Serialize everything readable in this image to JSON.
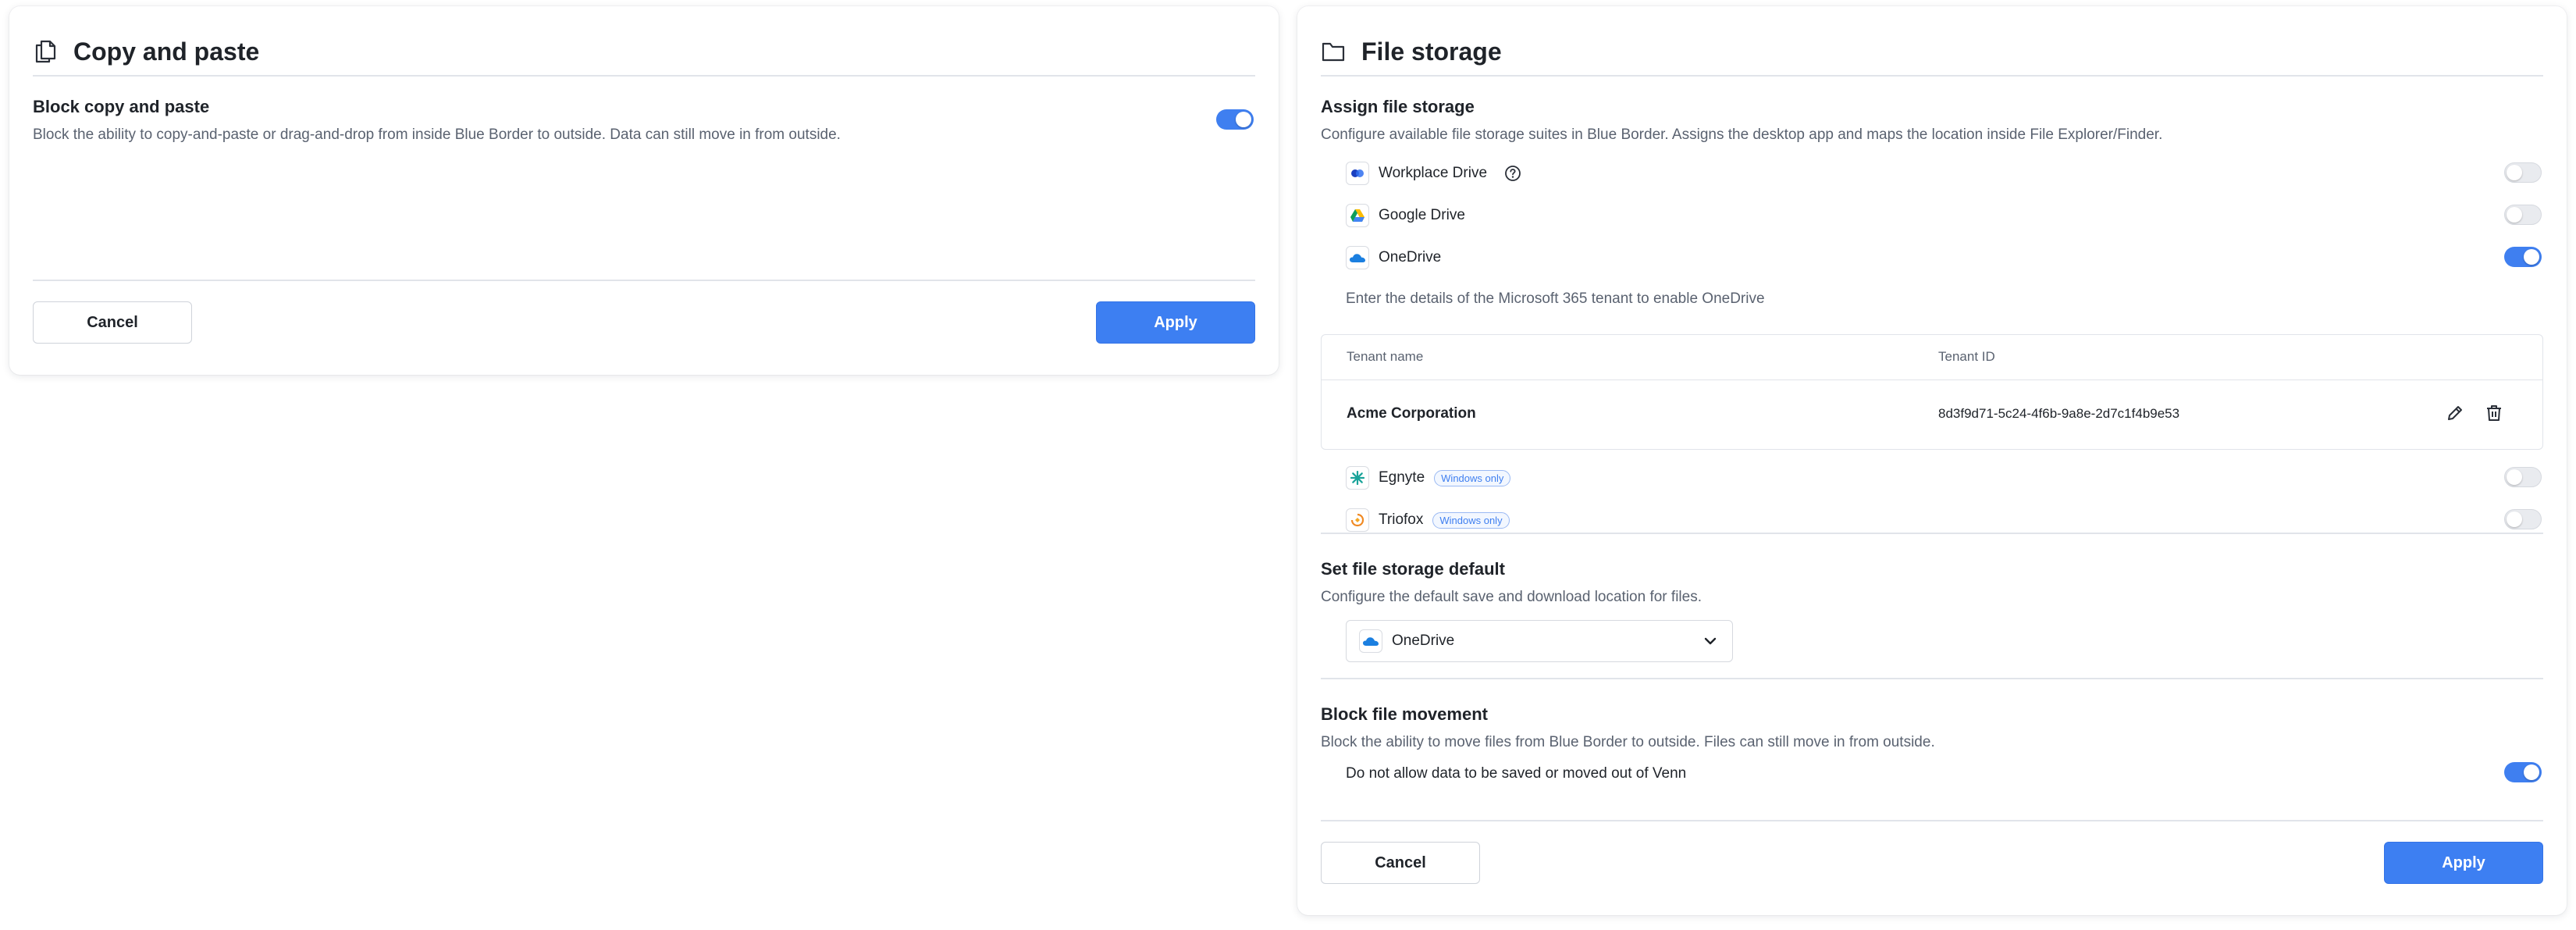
{
  "copy_paste": {
    "title": "Copy and paste",
    "icon": "copy-icon",
    "setting_title": "Block copy and paste",
    "setting_desc": "Block the ability to copy-and-paste or drag-and-drop from inside Blue Border to outside. Data can still move in from outside.",
    "toggle_on": true,
    "cancel_label": "Cancel",
    "apply_label": "Apply"
  },
  "file_storage": {
    "title": "File storage",
    "icon": "folder-icon",
    "assign": {
      "title": "Assign file storage",
      "desc": "Configure available file storage suites in Blue Border. Assigns the desktop app and maps the location inside File Explorer/Finder.",
      "providers": [
        {
          "name": "Workplace Drive",
          "icon": "workplace-drive-icon",
          "enabled": false,
          "help": true
        },
        {
          "name": "Google Drive",
          "icon": "google-drive-icon",
          "enabled": false
        },
        {
          "name": "OneDrive",
          "icon": "onedrive-icon",
          "enabled": true
        },
        {
          "name": "Egnyte",
          "icon": "egnyte-icon",
          "enabled": false,
          "badge": "Windows only"
        },
        {
          "name": "Triofox",
          "icon": "triofox-icon",
          "enabled": false,
          "badge": "Windows only"
        }
      ],
      "onedrive_note": "Enter the details of the Microsoft 365 tenant to enable OneDrive",
      "tenant_table": {
        "headers": [
          "Tenant name",
          "Tenant ID"
        ],
        "rows": [
          [
            "Acme Corporation",
            "8d3f9d71-5c24-4f6b-9a8e-2d7c1f4b9e53"
          ]
        ]
      }
    },
    "default": {
      "title": "Set file storage default",
      "desc": "Configure the default save and download location for files.",
      "selected": "OneDrive"
    },
    "block": {
      "title": "Block file movement",
      "desc": "Block the ability to move files from Blue Border to outside.  Files can still move in from outside.",
      "option_label": "Do not allow data to be saved or moved out of Venn",
      "option_on": true
    },
    "cancel_label": "Cancel",
    "apply_label": "Apply"
  },
  "colors": {
    "accent": "#3d7ff2",
    "toggle_off": "#e9ebef",
    "divider": "#e1e4ea"
  }
}
